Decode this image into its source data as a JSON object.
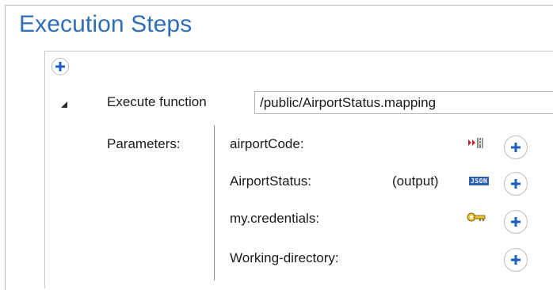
{
  "section": {
    "title": "Execution Steps"
  },
  "step": {
    "label": "Execute function",
    "function_path": "/public/AirportStatus.mapping",
    "parameters_label": "Parameters:",
    "parameters": [
      {
        "name": "airportCode:",
        "icon": "input-text-icon"
      },
      {
        "name": "AirportStatus:",
        "output_label": "(output)",
        "icon": "json-icon",
        "badge": "JSON"
      },
      {
        "name": "my.credentials:",
        "icon": "key-icon"
      },
      {
        "name": "Working-directory:",
        "icon": ""
      }
    ]
  },
  "colors": {
    "title": "#2f6db5",
    "accent": "#2a5fb4",
    "key": "#e8c43a",
    "input_icon": "#c0262b"
  }
}
